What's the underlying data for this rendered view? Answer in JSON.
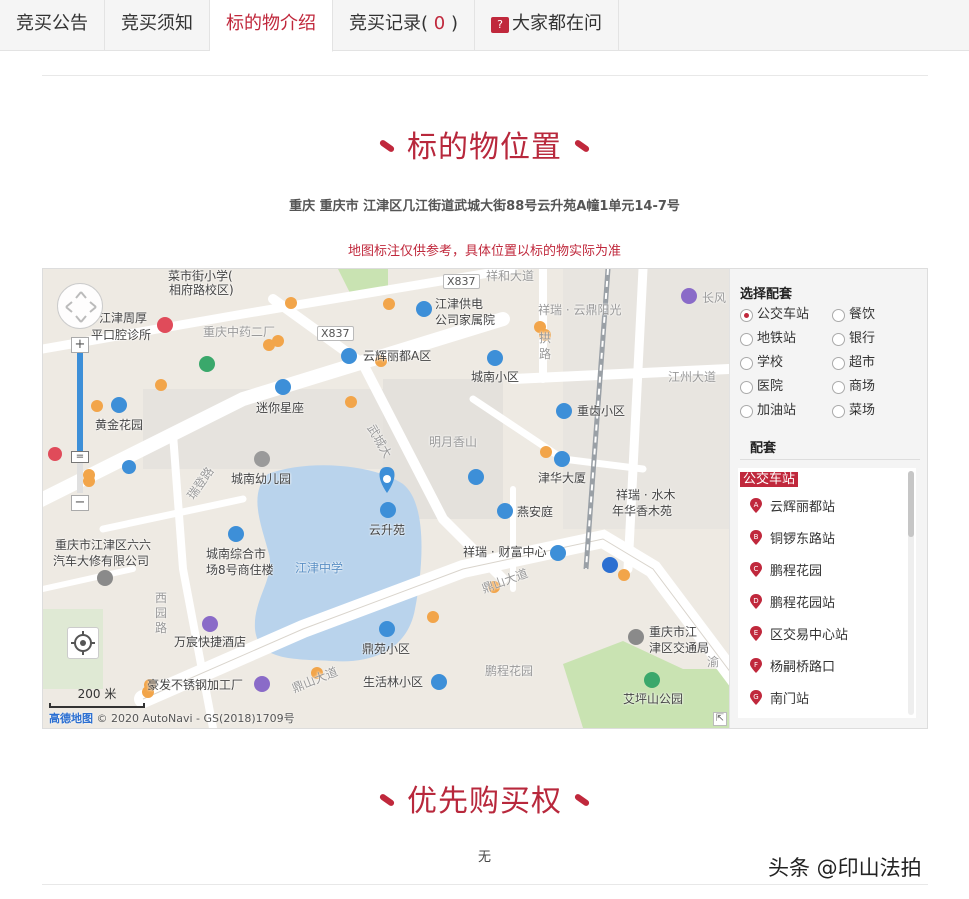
{
  "tabs": [
    {
      "label": "竞买公告"
    },
    {
      "label": "竞买须知"
    },
    {
      "label": "标的物介绍"
    },
    {
      "label": "竞买记录",
      "count_open": "(",
      "count": "0",
      "count_close": ")"
    },
    {
      "label": "大家都在问",
      "icon": "question-badge-icon"
    }
  ],
  "location": {
    "title": "标的物位置",
    "address": "重庆 重庆市 江津区几江街道武城大街88号云升苑A幢1单元14-7号",
    "notice": "地图标注仅供参考，具体位置以标的物实际为准"
  },
  "map": {
    "labels": {
      "l1": "菜市街小学(",
      "l2": "相府路校区)",
      "l3": "X837",
      "l4": "祥和大道",
      "l5": "江津周厚",
      "l6": "平口腔诊所",
      "l7": "重庆中药二厂",
      "l8": "X837",
      "l9": "江津供电",
      "l10": "公司家属院",
      "l11": "祥瑞 · 云鼎阳光",
      "l12": "长风",
      "l13": "云辉丽都A区",
      "l14": "城南小区",
      "l15": "江州大道",
      "l16": "迷你星座",
      "l17": "黄金花园",
      "l18": "重齿小区",
      "l19": "明月香山",
      "l20": "城南幼儿园",
      "l21": "津华大厦",
      "l22": "祥瑞 · 水木",
      "l23": "年华香木苑",
      "l24": "云升苑",
      "l25": "燕安庭",
      "l26": "重庆市江津区六六",
      "l27": "汽车大修有限公司",
      "l28": "城南综合市",
      "l29": "场8号商住楼",
      "l30": "江津中学",
      "l31": "祥瑞 · 财富中心",
      "l32": "鼎山大道",
      "l33": "西",
      "l34": "园",
      "l35": "路",
      "l36": "万宸快捷酒店",
      "l37": "鼎苑小区",
      "l38": "重庆市江",
      "l39": "津区交通局",
      "l40": "鹏程花园",
      "l41": "豪发不锈钢加工厂",
      "l42": "生活林小区",
      "l43": "鼎山大道",
      "l44": "艾坪山公园",
      "l45": "渝",
      "l46": "武城大",
      "l47": "拱",
      "l48": "路",
      "l49": "瑞登路"
    },
    "scale_label": "200 米",
    "copyright_logo": "高德地图",
    "copyright": "© 2020 AutoNavi - GS(2018)1709号"
  },
  "panel": {
    "title": "选择配套",
    "options": [
      {
        "label": "公交车站",
        "checked": true
      },
      {
        "label": "餐饮",
        "checked": false
      },
      {
        "label": "地铁站",
        "checked": false
      },
      {
        "label": "银行",
        "checked": false
      },
      {
        "label": "学校",
        "checked": false
      },
      {
        "label": "超市",
        "checked": false
      },
      {
        "label": "医院",
        "checked": false
      },
      {
        "label": "商场",
        "checked": false
      },
      {
        "label": "加油站",
        "checked": false
      },
      {
        "label": "菜场",
        "checked": false
      }
    ],
    "subtitle": "配套",
    "category": "公交车站",
    "stops": [
      {
        "letter": "A",
        "name": "云辉丽都站"
      },
      {
        "letter": "B",
        "name": "铜锣东路站"
      },
      {
        "letter": "C",
        "name": "鹏程花园"
      },
      {
        "letter": "D",
        "name": "鹏程花园站"
      },
      {
        "letter": "E",
        "name": "区交易中心站"
      },
      {
        "letter": "F",
        "name": "杨嗣桥路口"
      },
      {
        "letter": "G",
        "name": "南门站"
      }
    ]
  },
  "preemption": {
    "title": "优先购买权",
    "value": "无"
  },
  "watermark": "头条 @印山法拍",
  "colors": {
    "accent": "#c0283c",
    "map_water": "#b9d3ec",
    "map_green": "#c9e3b2",
    "marker_blue": "#3d8fd8"
  }
}
